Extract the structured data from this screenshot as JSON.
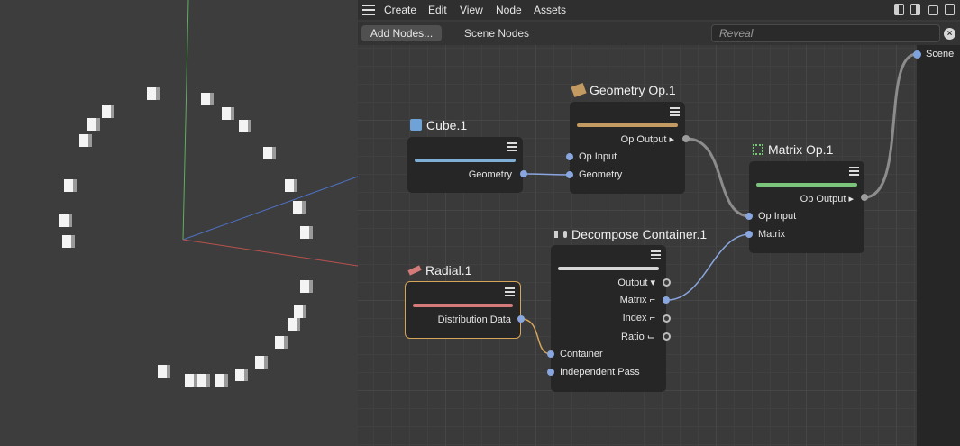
{
  "menubar": {
    "items": [
      "Create",
      "Edit",
      "View",
      "Node",
      "Assets"
    ]
  },
  "toolbar": {
    "add_nodes": "Add Nodes...",
    "scene_nodes": "Scene Nodes",
    "search_placeholder": "Reveal"
  },
  "scene_port": {
    "label": "Scene"
  },
  "nodes": {
    "cube": {
      "title": "Cube.1",
      "bar_color": "#7faed6",
      "ports": [
        "Geometry"
      ]
    },
    "geometry": {
      "title": "Geometry Op.1",
      "bar_color": "#c39b62",
      "ports": [
        "Op Output",
        "Op Input",
        "Geometry"
      ]
    },
    "matrix": {
      "title": "Matrix Op.1",
      "bar_color": "#7cc47c",
      "ports": [
        "Op Output",
        "Op Input",
        "Matrix"
      ]
    },
    "radial": {
      "title": "Radial.1",
      "bar_color": "#d47a78",
      "ports": [
        "Distribution Data"
      ]
    },
    "decompose": {
      "title": "Decompose Container.1",
      "bar_color": "#d6d6d6",
      "ports": [
        "Output",
        "Matrix",
        "Index",
        "Ratio",
        "Container",
        "Independent Pass"
      ]
    }
  },
  "colors": {
    "port_blue": "#8aa6de",
    "wire_grey": "#8c8c8c",
    "wire_orange": "#d6a55a",
    "selection": "#d6a55a"
  }
}
